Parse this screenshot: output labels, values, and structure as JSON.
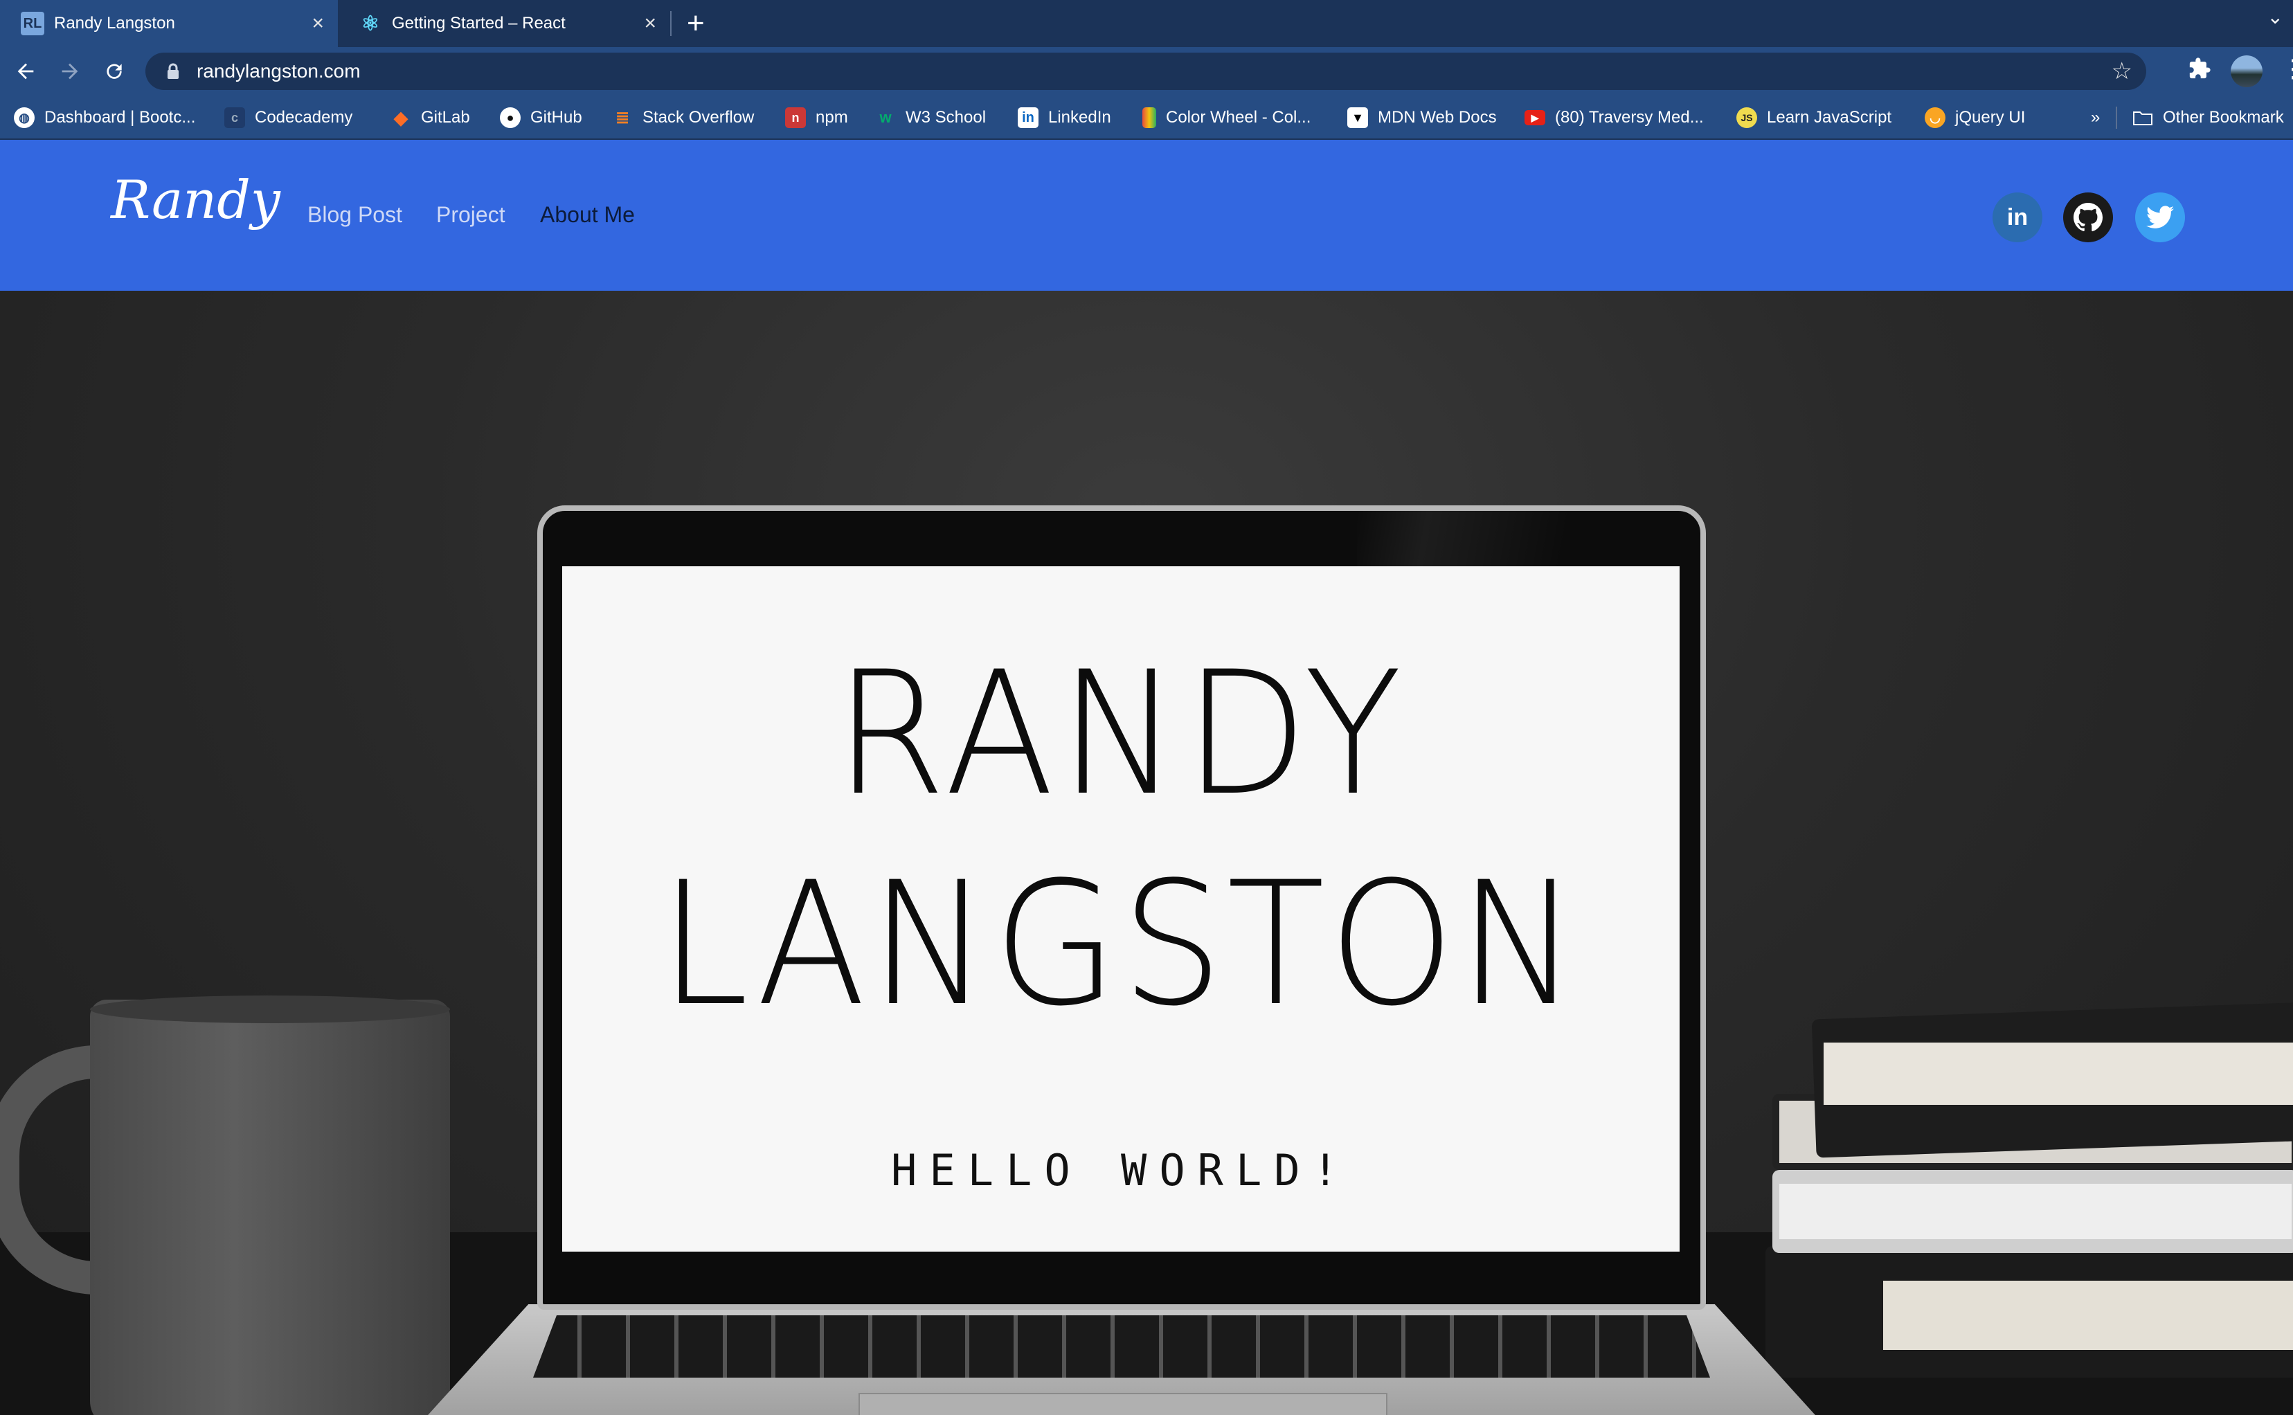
{
  "browser": {
    "tabs": [
      {
        "label": "Randy Langston",
        "favicon": "RL"
      },
      {
        "label": "Getting Started – React",
        "favicon": "⚛"
      }
    ],
    "url": "randylangston.com",
    "bookmarks": [
      {
        "label": "Dashboard | Bootc...",
        "icon": "globe-icon"
      },
      {
        "label": "Codecademy",
        "icon": "codecademy-icon"
      },
      {
        "label": "GitLab",
        "icon": "gitlab-icon"
      },
      {
        "label": "GitHub",
        "icon": "github-icon"
      },
      {
        "label": "Stack Overflow",
        "icon": "stackoverflow-icon"
      },
      {
        "label": "npm",
        "icon": "npm-icon"
      },
      {
        "label": "W3 School",
        "icon": "w3schools-icon"
      },
      {
        "label": "LinkedIn",
        "icon": "linkedin-icon"
      },
      {
        "label": "Color Wheel - Col...",
        "icon": "color-wheel-icon"
      },
      {
        "label": "MDN Web Docs",
        "icon": "mdn-icon"
      },
      {
        "label": "(80) Traversy Med...",
        "icon": "youtube-icon"
      },
      {
        "label": "Learn JavaScript",
        "icon": "js-icon"
      },
      {
        "label": "jQuery UI",
        "icon": "jquery-icon"
      }
    ],
    "overflow": "»",
    "other_bookmarks": "Other Bookmark"
  },
  "site": {
    "brand": "Randy",
    "nav": [
      "Blog Post",
      "Project",
      "About Me"
    ],
    "social": [
      "linkedin-icon",
      "github-icon",
      "twitter-icon"
    ],
    "hero": {
      "first_name": "RANDY",
      "last_name": "LANGSTON",
      "tagline": "HELLO WORLD!"
    }
  },
  "colors": {
    "header_bg": "#3367e0",
    "browser_frame": "#1b3358",
    "toolbar": "#264c83"
  }
}
